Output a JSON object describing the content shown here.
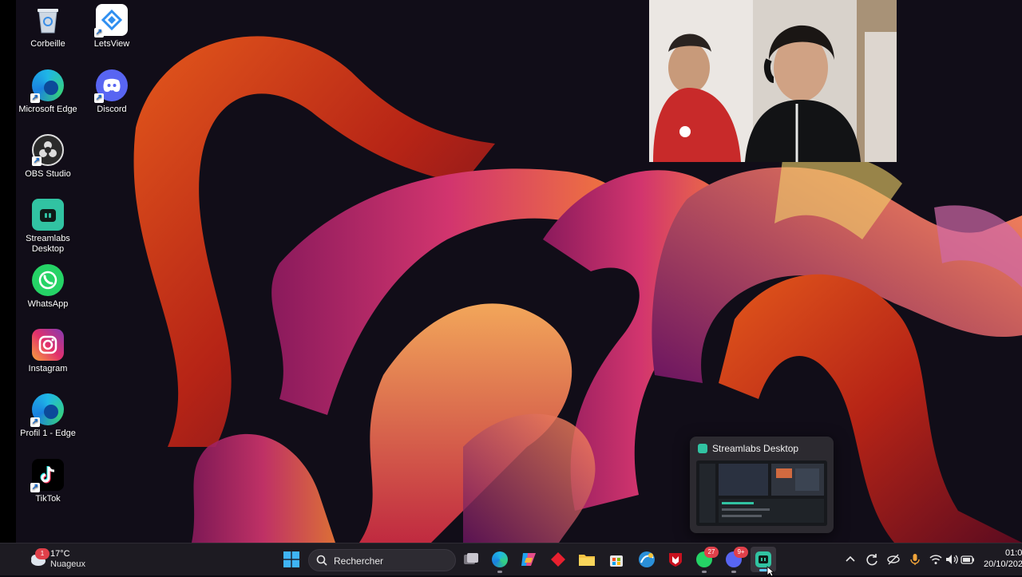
{
  "desktop": {
    "icons": [
      {
        "name": "recycle-bin-icon",
        "label": "Corbeille"
      },
      {
        "name": "letsview-icon",
        "label": "LetsView"
      },
      {
        "name": "edge-icon",
        "label": "Microsoft Edge"
      },
      {
        "name": "discord-icon",
        "label": "Discord"
      },
      {
        "name": "obs-icon",
        "label": "OBS Studio"
      },
      {
        "name": "streamlabs-icon",
        "label": "Streamlabs Desktop"
      },
      {
        "name": "whatsapp-icon",
        "label": "WhatsApp"
      },
      {
        "name": "instagram-icon",
        "label": "Instagram"
      },
      {
        "name": "edge-profile-icon",
        "label": "Profil 1 - Edge"
      },
      {
        "name": "tiktok-icon",
        "label": "TikTok"
      }
    ]
  },
  "preview": {
    "title": "Streamlabs Desktop"
  },
  "taskbar": {
    "weather": {
      "temp": "17°C",
      "desc": "Nuageux",
      "badge": "1"
    },
    "search": {
      "placeholder": "Rechercher"
    },
    "badges": {
      "whatsapp": "27",
      "discord": "9+"
    },
    "clock": {
      "time": "01:0",
      "date": "20/10/202"
    }
  },
  "colors": {
    "accent": "#61c8ff",
    "streamlabs": "#31c3a2",
    "badge": "#e0404a"
  }
}
